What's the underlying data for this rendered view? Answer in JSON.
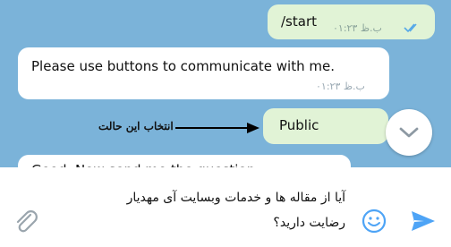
{
  "messages": [
    {
      "text": "/start",
      "time": "ب.ظ ۰۱:۲۳",
      "status_icon": "double-check-icon"
    },
    {
      "text": "Please use buttons to communicate with me.",
      "time": "ب.ظ ۰۱:۲۳"
    },
    {
      "text": "Public"
    },
    {
      "text": "Good. Now send me the question."
    }
  ],
  "annotation": {
    "text": "انتخاب این حالت"
  },
  "composer": {
    "input_value": "آیا از مقاله ها و خدمات وبسایت آی مهدیار رضایت دارید؟",
    "attach_icon": "paperclip-icon",
    "emoji_icon": "emoji-icon",
    "send_icon": "send-icon"
  },
  "scroll_button": {
    "icon": "chevron-down-icon"
  },
  "colors": {
    "background": "#7bb3d9",
    "outgoing": "#e1f3d6",
    "incoming": "#ffffff",
    "accent": "#4ea4f6"
  }
}
